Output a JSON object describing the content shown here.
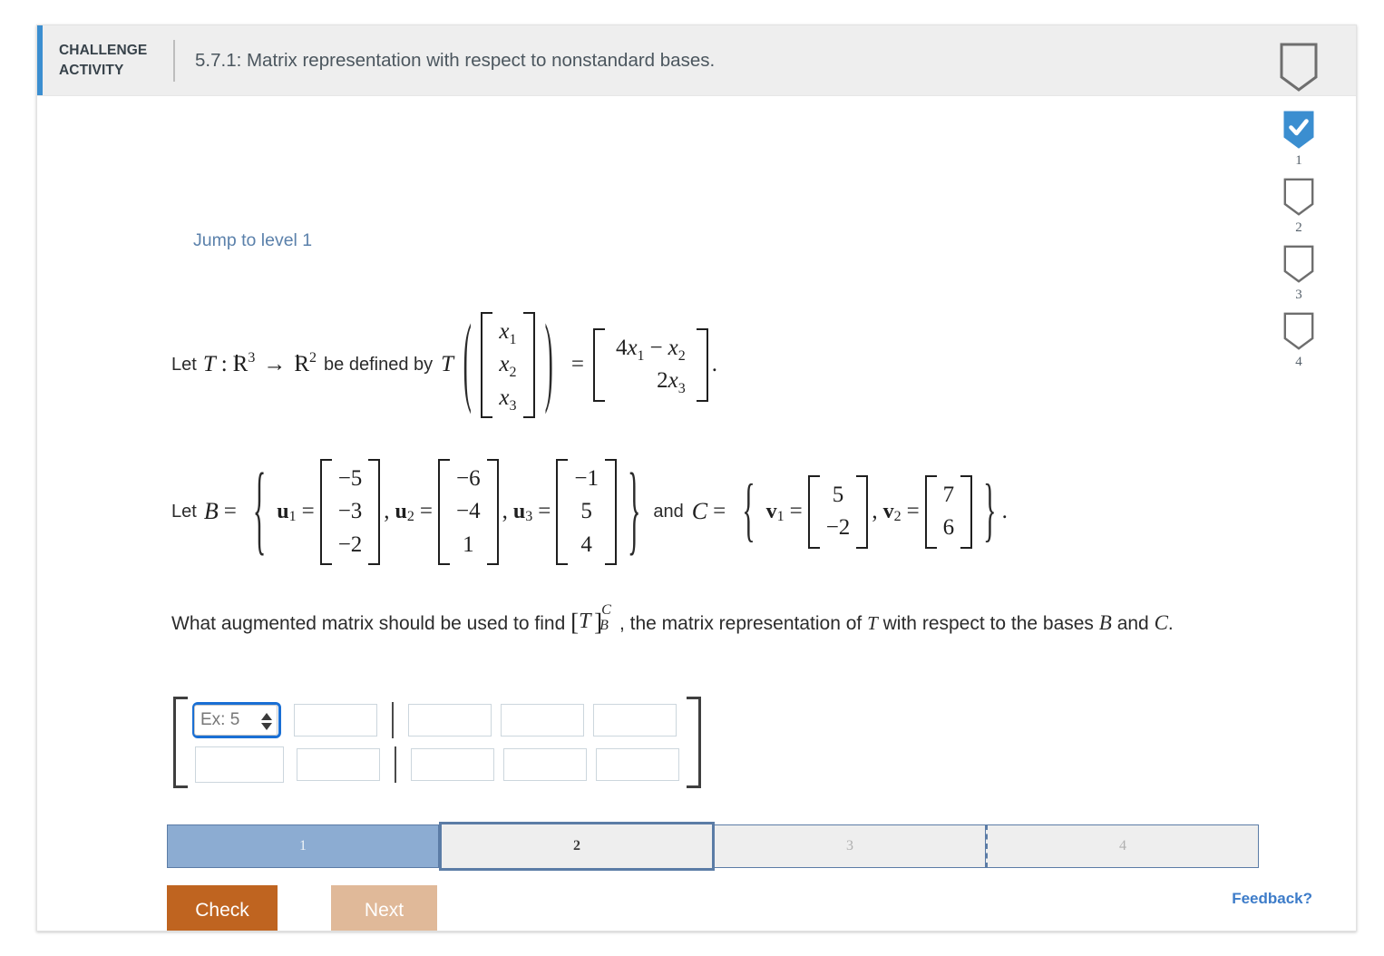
{
  "header": {
    "challenge_label_line1": "CHALLENGE",
    "challenge_label_line2": "ACTIVITY",
    "title": "5.7.1: Matrix representation with respect to nonstandard bases.",
    "shield_icon": "shield-outline-icon",
    "accent_color": "#3b8ed0",
    "background_color": "#eeeeee"
  },
  "levels": {
    "items": [
      {
        "number": "1",
        "state": "completed",
        "icon": "shield-check-icon"
      },
      {
        "number": "2",
        "state": "pending",
        "icon": "shield-outline-icon"
      },
      {
        "number": "3",
        "state": "pending",
        "icon": "shield-outline-icon"
      },
      {
        "number": "4",
        "state": "pending",
        "icon": "shield-outline-icon"
      }
    ],
    "completed_color": "#3b8ed0"
  },
  "jump_link": "Jump to level 1",
  "problem": {
    "let_text": "Let",
    "T": "T",
    "colon": ":",
    "domain": "R",
    "domain_exp": "3",
    "arrow": "→",
    "codomain": "R",
    "codomain_exp": "2",
    "defined_by": "be defined by",
    "T2": "T",
    "input_vector": [
      "x1",
      "x2",
      "x3"
    ],
    "input_vector_parts": [
      {
        "base": "x",
        "sub": "1"
      },
      {
        "base": "x",
        "sub": "2"
      },
      {
        "base": "x",
        "sub": "3"
      }
    ],
    "equals": "=",
    "output_rows": [
      {
        "coef": "4",
        "var": "x",
        "sub": "1",
        "op": "−",
        "var2": "x",
        "sub2": "2"
      },
      {
        "coef": "2",
        "var": "x",
        "sub": "3"
      }
    ],
    "period": "."
  },
  "bases": {
    "let_text": "Let",
    "B_symbol": "B",
    "equals": "=",
    "B_vectors": [
      {
        "name": "u",
        "index": "1",
        "values": [
          "−5",
          "−3",
          "−2"
        ]
      },
      {
        "name": "u",
        "index": "2",
        "values": [
          "−6",
          "−4",
          "1"
        ]
      },
      {
        "name": "u",
        "index": "3",
        "values": [
          "−1",
          "5",
          "4"
        ]
      }
    ],
    "and_text": "and",
    "C_symbol": "C",
    "C_vectors": [
      {
        "name": "v",
        "index": "1",
        "values": [
          "5",
          "−2"
        ]
      },
      {
        "name": "v",
        "index": "2",
        "values": [
          "7",
          "6"
        ]
      }
    ],
    "comma": ",",
    "period": "."
  },
  "question": {
    "part1": "What augmented matrix should be used to find",
    "matrix_notation": {
      "left_bracket": "[",
      "T": "T",
      "right_bracket": "]",
      "superscript": "C",
      "subscript": "B"
    },
    "part2": ", the matrix representation of",
    "T": "T",
    "part3": "with respect to the bases",
    "B_symbol": "B",
    "part4": "and",
    "C_symbol": "C",
    "period": "."
  },
  "answer_matrix": {
    "rows": 2,
    "cols": 5,
    "augmented_after_col": 2,
    "focused_cell": {
      "row": 0,
      "col": 0
    },
    "placeholder": "Ex: 5",
    "cell_values": [
      [
        "",
        "",
        "",
        "",
        ""
      ],
      [
        "",
        "",
        "",
        "",
        ""
      ]
    ],
    "spinner_icon": "number-spinner-icon"
  },
  "progress": {
    "segments": [
      {
        "label": "1",
        "state": "completed"
      },
      {
        "label": "2",
        "state": "current"
      },
      {
        "label": "3",
        "state": "todo"
      },
      {
        "label": "4",
        "state": "todo"
      }
    ],
    "completed_color": "#8cacd2",
    "border_color": "#5b7ca6"
  },
  "actions": {
    "check_label": "Check",
    "check_color": "#bf6420",
    "next_label": "Next",
    "next_color": "#e0b999"
  },
  "feedback_link": "Feedback?"
}
